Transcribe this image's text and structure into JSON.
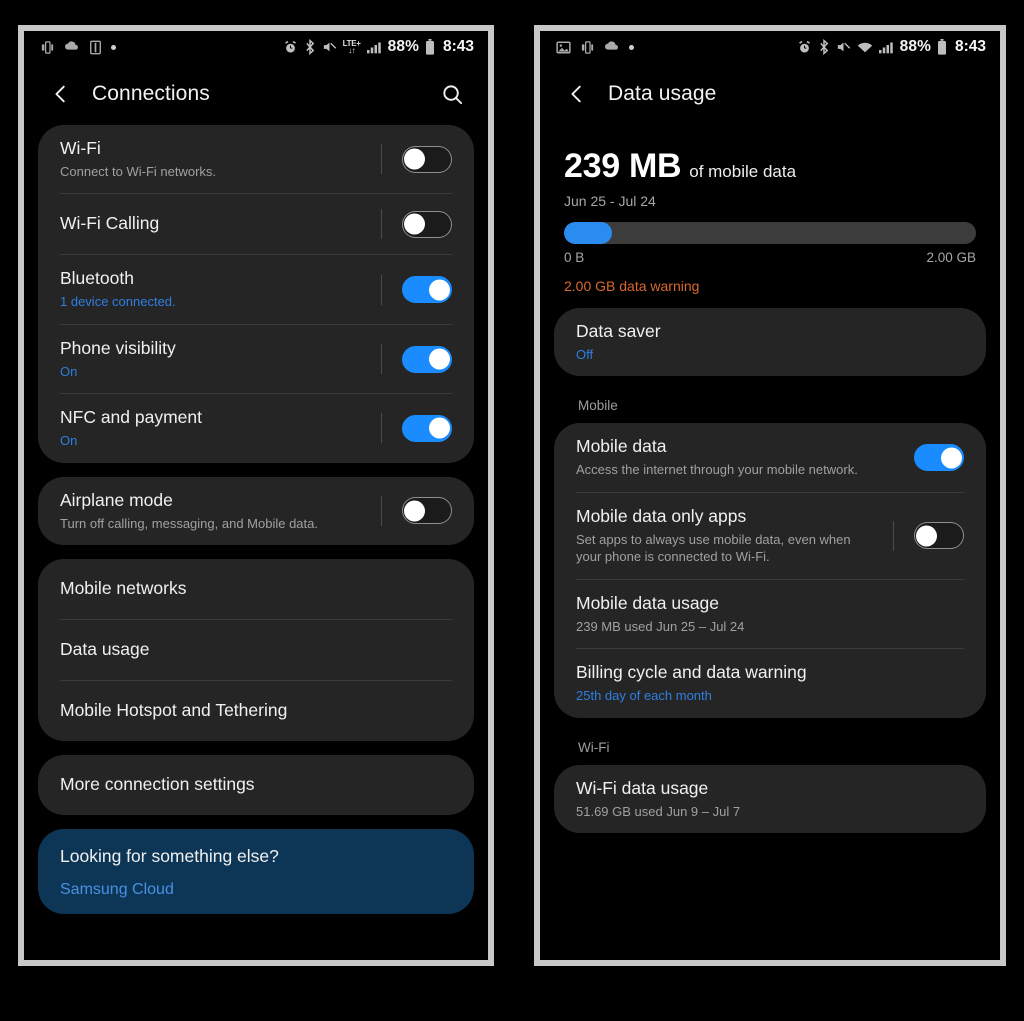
{
  "left_phone": {
    "status_bar": {
      "left_icons": [
        "screen-mirror-icon",
        "cloud-sync-icon",
        "sd-card-icon",
        "dot-icon"
      ],
      "alarm_icon": "alarm-icon",
      "bluetooth_icon": "bluetooth-icon",
      "mute_icon": "mute-icon",
      "network_label": "LTE+",
      "network_arrows": "↓↑",
      "signal_icon": "signal-bars-icon",
      "battery_percent": "88%",
      "battery_icon": "battery-icon",
      "time": "8:43"
    },
    "appbar": {
      "back_icon": "back-chevron-icon",
      "title": "Connections",
      "search_icon": "search-icon"
    },
    "cards": [
      {
        "rows": [
          {
            "title": "Wi-Fi",
            "sub": "Connect to Wi-Fi networks.",
            "sub_style": "muted",
            "toggle": "off"
          },
          {
            "title": "Wi-Fi Calling",
            "sub": "",
            "sub_style": "muted",
            "toggle": "off"
          },
          {
            "title": "Bluetooth",
            "sub": "1 device connected.",
            "sub_style": "accent",
            "toggle": "on"
          },
          {
            "title": "Phone visibility",
            "sub": "On",
            "sub_style": "accent",
            "toggle": "on"
          },
          {
            "title": "NFC and payment",
            "sub": "On",
            "sub_style": "accent",
            "toggle": "on"
          }
        ]
      },
      {
        "rows": [
          {
            "title": "Airplane mode",
            "sub": "Turn off calling, messaging, and Mobile data.",
            "sub_style": "muted",
            "toggle": "off"
          }
        ]
      },
      {
        "rows": [
          {
            "title": "Mobile networks",
            "sub": "",
            "sub_style": "muted",
            "toggle": "none"
          },
          {
            "title": "Data usage",
            "sub": "",
            "sub_style": "muted",
            "toggle": "none"
          },
          {
            "title": "Mobile Hotspot and Tethering",
            "sub": "",
            "sub_style": "muted",
            "toggle": "none"
          }
        ]
      },
      {
        "rows": [
          {
            "title": "More connection settings",
            "sub": "",
            "sub_style": "muted",
            "toggle": "none"
          }
        ]
      }
    ],
    "promo_card": {
      "title": "Looking for something else?",
      "link": "Samsung Cloud"
    }
  },
  "right_phone": {
    "status_bar": {
      "left_icons": [
        "screenshot-icon",
        "screen-mirror-icon",
        "cloud-sync-icon",
        "dot-icon"
      ],
      "alarm_icon": "alarm-icon",
      "bluetooth_icon": "bluetooth-icon",
      "mute_icon": "mute-icon",
      "wifi_icon": "wifi-icon",
      "signal_icon": "signal-bars-icon",
      "battery_percent": "88%",
      "battery_icon": "battery-icon",
      "time": "8:43"
    },
    "appbar": {
      "back_icon": "back-chevron-icon",
      "title": "Data usage"
    },
    "usage_summary": {
      "amount": "239 MB",
      "amount_suffix": "of mobile data",
      "period": "Jun 25 - Jul 24",
      "bar_min_label": "0 B",
      "bar_max_label": "2.00 GB",
      "bar_percent": 11.7,
      "warning": "2.00 GB data warning"
    },
    "data_saver": {
      "title": "Data saver",
      "sub": "Off"
    },
    "mobile_section_label": "Mobile",
    "mobile_rows": [
      {
        "title": "Mobile data",
        "sub": "Access the internet through your mobile network.",
        "sub_style": "muted",
        "toggle": "on"
      },
      {
        "title": "Mobile data only apps",
        "sub": "Set apps to always use mobile data, even when your phone is connected to Wi-Fi.",
        "sub_style": "muted",
        "toggle": "off"
      },
      {
        "title": "Mobile data usage",
        "sub": "239 MB used Jun 25 – Jul 24",
        "sub_style": "muted",
        "toggle": "none"
      },
      {
        "title": "Billing cycle and data warning",
        "sub": "25th day of each month",
        "sub_style": "accent",
        "toggle": "none"
      }
    ],
    "wifi_section_label": "Wi-Fi",
    "wifi_rows": [
      {
        "title": "Wi-Fi data usage",
        "sub": "51.69 GB used Jun 9 – Jul 7",
        "sub_style": "muted",
        "toggle": "none"
      }
    ]
  },
  "colors": {
    "accent_blue": "#1a8cff",
    "link_blue": "#2e7fe0",
    "warning_orange": "#d9682f",
    "card_bg": "#252525",
    "promo_bg": "#0d3656",
    "screen_bg": "#000000"
  }
}
